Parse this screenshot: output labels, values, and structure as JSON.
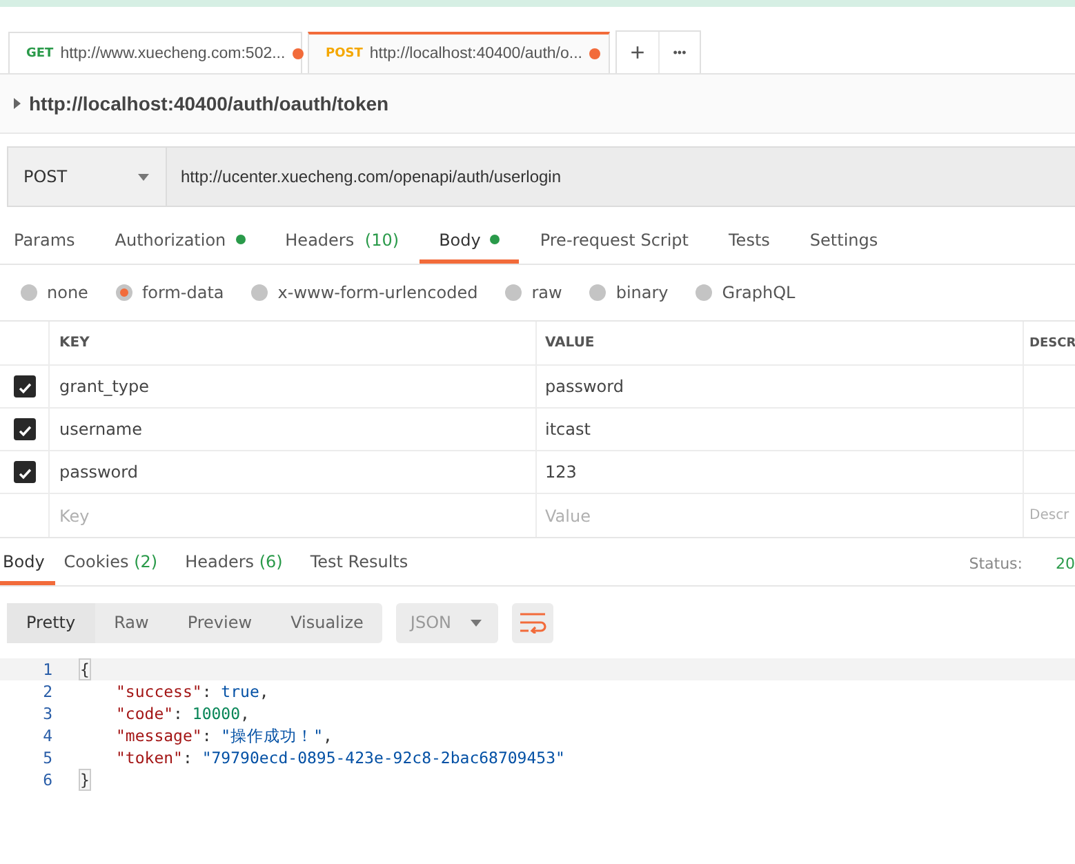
{
  "request_tabs": [
    {
      "method": "GET",
      "kind": "get",
      "url": "http://www.xuecheng.com:502...",
      "unsaved": true,
      "selected": false
    },
    {
      "method": "POST",
      "kind": "post",
      "url": "http://localhost:40400/auth/o...",
      "unsaved": true,
      "selected": true
    }
  ],
  "tab_actions": {
    "add": "+",
    "more": "•••"
  },
  "request_name": "http://localhost:40400/auth/oauth/token",
  "request_bar": {
    "method": "POST",
    "url": "http://ucenter.xuecheng.com/openapi/auth/userlogin"
  },
  "request_sections": [
    {
      "label": "Params",
      "selected": false,
      "dot": false
    },
    {
      "label": "Authorization",
      "selected": false,
      "dot": true
    },
    {
      "label": "Headers",
      "count": "(10)",
      "selected": false,
      "dot": false
    },
    {
      "label": "Body",
      "selected": true,
      "dot": true
    },
    {
      "label": "Pre-request Script",
      "selected": false,
      "dot": false
    },
    {
      "label": "Tests",
      "selected": false,
      "dot": false
    },
    {
      "label": "Settings",
      "selected": false,
      "dot": false
    }
  ],
  "body_types": [
    {
      "label": "none",
      "selected": false
    },
    {
      "label": "form-data",
      "selected": true
    },
    {
      "label": "x-www-form-urlencoded",
      "selected": false
    },
    {
      "label": "raw",
      "selected": false
    },
    {
      "label": "binary",
      "selected": false
    },
    {
      "label": "GraphQL",
      "selected": false
    }
  ],
  "params_table": {
    "columns": [
      "KEY",
      "VALUE",
      "DESCR"
    ],
    "rows": [
      {
        "checked": true,
        "key": "grant_type",
        "value": "password"
      },
      {
        "checked": true,
        "key": "username",
        "value": "itcast"
      },
      {
        "checked": true,
        "key": "password",
        "value": "123"
      }
    ],
    "new_row": {
      "key": {
        "placeholder": "Key"
      },
      "value": {
        "placeholder": "Value"
      },
      "description": {
        "placeholder": "Descr"
      }
    }
  },
  "response_tabs": [
    {
      "label": "Body",
      "selected": true
    },
    {
      "label": "Cookies",
      "count": "(2)",
      "selected": false
    },
    {
      "label": "Headers",
      "count": "(6)",
      "selected": false
    },
    {
      "label": "Test Results",
      "selected": false
    }
  ],
  "status": {
    "label": "Status:",
    "value": "20"
  },
  "view_modes": [
    {
      "label": "Pretty",
      "selected": true
    },
    {
      "label": "Raw",
      "selected": false
    },
    {
      "label": "Preview",
      "selected": false
    },
    {
      "label": "Visualize",
      "selected": false
    }
  ],
  "format": "JSON",
  "code_lines": [
    {
      "number": "1",
      "tokens": [
        {
          "kind": "punct",
          "text": "{"
        }
      ]
    },
    {
      "number": "2",
      "tokens": [
        {
          "kind": "key",
          "text": "\"success\""
        },
        {
          "kind": "punct",
          "text": ": "
        },
        {
          "kind": "bool",
          "text": "true"
        },
        {
          "kind": "punct",
          "text": ","
        }
      ]
    },
    {
      "number": "3",
      "tokens": [
        {
          "kind": "key",
          "text": "\"code\""
        },
        {
          "kind": "punct",
          "text": ": "
        },
        {
          "kind": "number",
          "text": "10000"
        },
        {
          "kind": "punct",
          "text": ","
        }
      ]
    },
    {
      "number": "4",
      "tokens": [
        {
          "kind": "key",
          "text": "\"message\""
        },
        {
          "kind": "punct",
          "text": ": "
        },
        {
          "kind": "string",
          "text": "\"操作成功！\""
        },
        {
          "kind": "punct",
          "text": ","
        }
      ]
    },
    {
      "number": "5",
      "tokens": [
        {
          "kind": "key",
          "text": "\"token\""
        },
        {
          "kind": "punct",
          "text": ": "
        },
        {
          "kind": "string",
          "text": "\"79790ecd-0895-423e-92c8-2bac68709453\""
        }
      ]
    },
    {
      "number": "6",
      "tokens": [
        {
          "kind": "punct",
          "text": "}"
        }
      ]
    }
  ]
}
